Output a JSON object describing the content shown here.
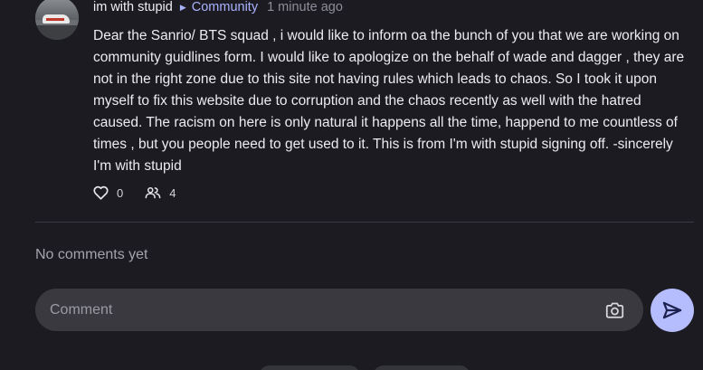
{
  "post": {
    "author": "im with stupid",
    "community": "Community",
    "time": "1 minute ago",
    "body": "Dear the Sanrio/ BTS squad , i would like to inform oa the bunch of you that we are working on community guidlines form. I would like to apologize on the behalf of wade and dagger , they are not in the right zone due to this site not having rules which leads to chaos. So I took it upon myself to fix this website due to corruption and the chaos recently as well with the hatred caused. The racism on here is only natural it happens all the time, happend to me countless of times , but you people need to get used to it. This is from I'm with stupid signing off. -sincerely I'm with stupid",
    "likes": "0",
    "members": "4"
  },
  "comments": {
    "empty_text": "No comments yet",
    "placeholder": "Comment"
  },
  "colors": {
    "background": "#1b1b21",
    "accent": "#a9b2ff",
    "send_button": "#b5bdff",
    "input_background": "#39393f"
  }
}
